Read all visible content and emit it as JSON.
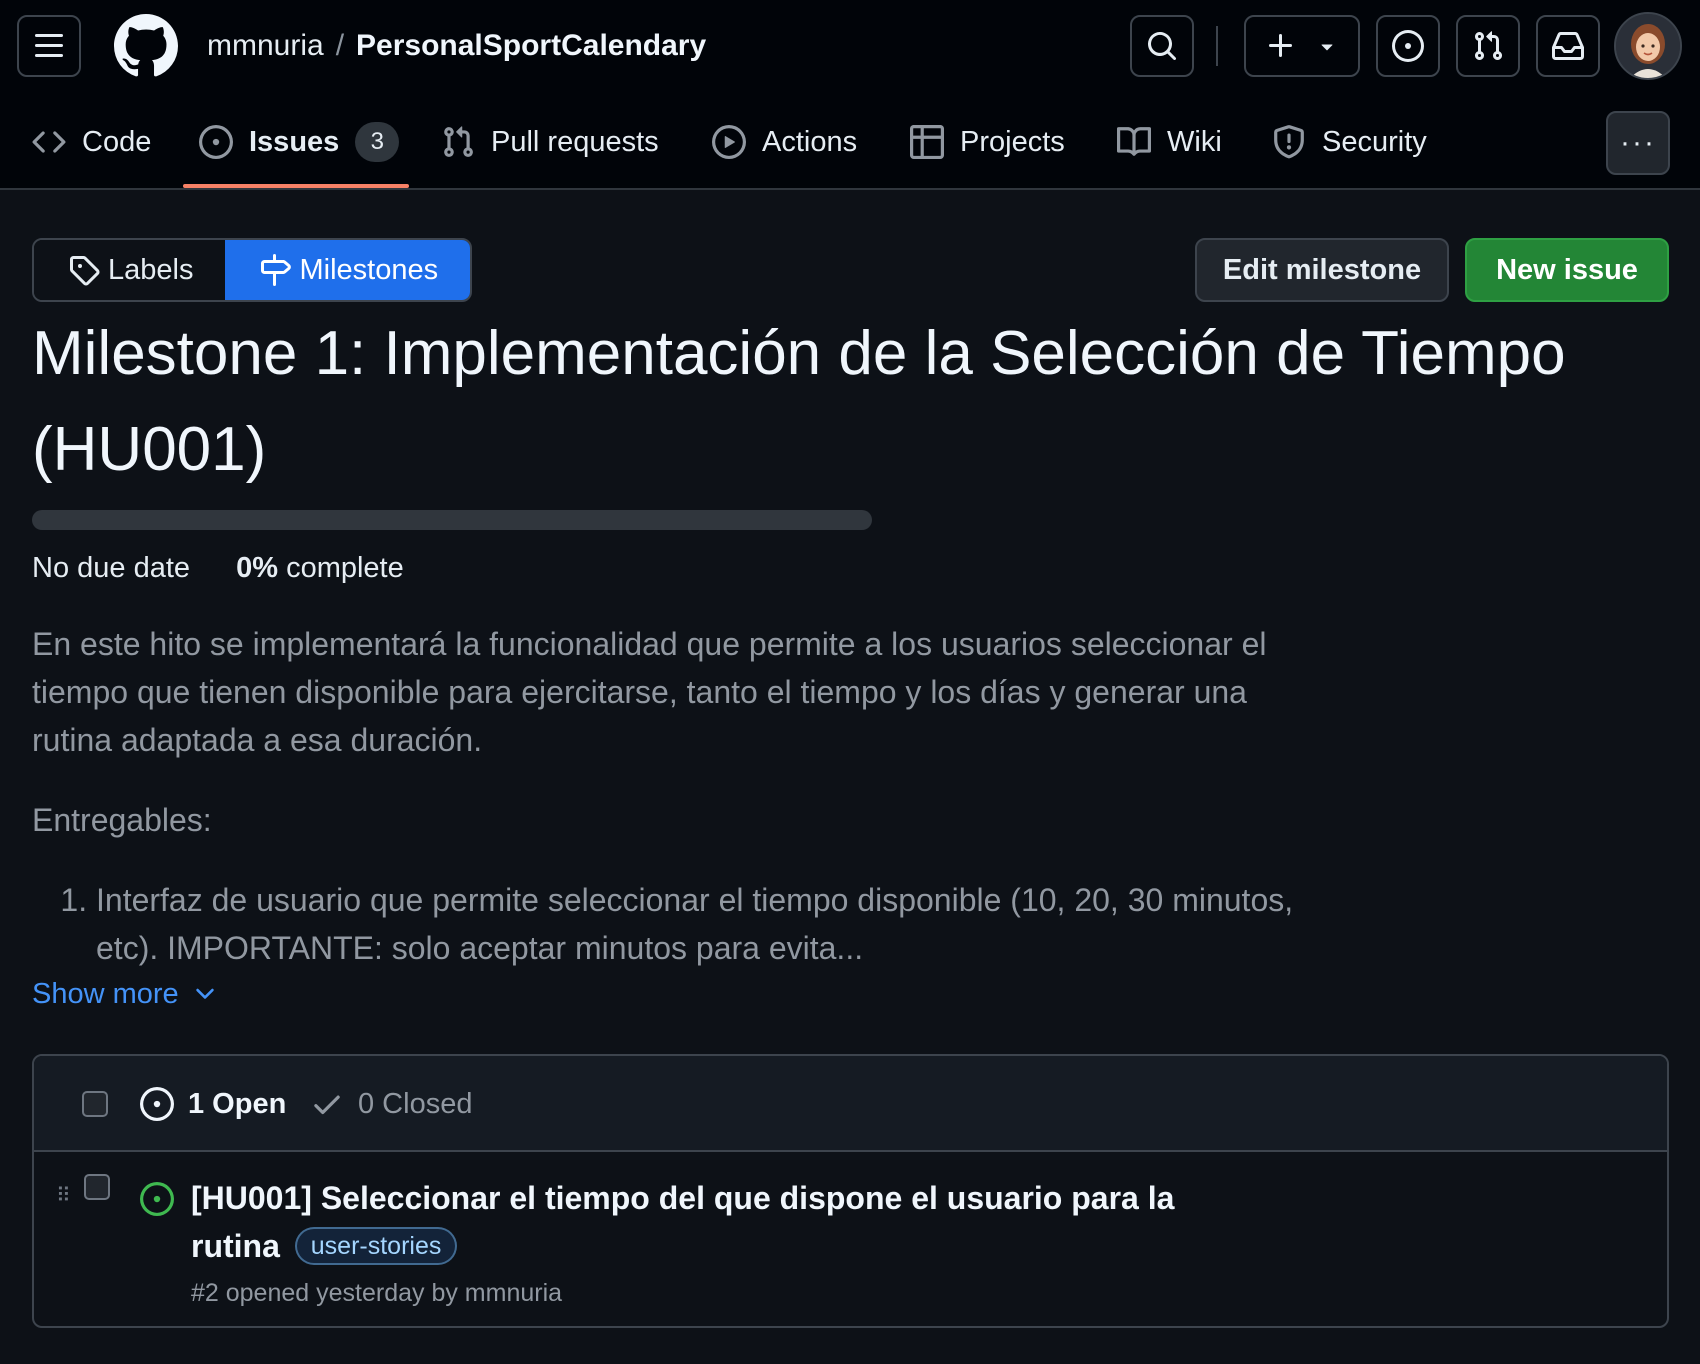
{
  "header": {
    "owner": "mmnuria",
    "separator": "/",
    "repo": "PersonalSportCalendary"
  },
  "nav": {
    "tabs": [
      {
        "label": "Code",
        "icon": "code-icon"
      },
      {
        "label": "Issues",
        "icon": "issue-opened-icon",
        "count": "3",
        "active": true
      },
      {
        "label": "Pull requests",
        "icon": "git-pull-request-icon"
      },
      {
        "label": "Actions",
        "icon": "play-icon"
      },
      {
        "label": "Projects",
        "icon": "table-icon"
      },
      {
        "label": "Wiki",
        "icon": "book-icon"
      },
      {
        "label": "Security",
        "icon": "shield-icon"
      }
    ],
    "more": "···"
  },
  "toolbar": {
    "labels": "Labels",
    "milestones": "Milestones",
    "edit_milestone": "Edit milestone",
    "new_issue": "New issue"
  },
  "milestone": {
    "title": "Milestone 1: Implementación de la Selección de Tiempo (HU001)",
    "progress_percent": 0,
    "due": "No due date",
    "percent": "0%",
    "percent_label": "complete",
    "description": {
      "paragraph": "En este hito se implementará la funcionalidad que permite a los usuarios seleccionar el tiempo que tienen disponible para ejercitarse, tanto el tiempo y los días y generar una rutina adaptada a esa duración.",
      "deliverables_heading": "Entregables:",
      "items": [
        "Interfaz de usuario que permite seleccionar el tiempo disponible (10, 20, 30 minutos, etc). IMPORTANTE: solo aceptar minutos para evita..."
      ]
    },
    "show_more": "Show more"
  },
  "issues": {
    "open_label": "1 Open",
    "closed_label": "0 Closed",
    "items": [
      {
        "title": "[HU001] Seleccionar el tiempo del que dispone el usuario para la rutina",
        "label": "user-stories",
        "meta": "#2 opened yesterday by mmnuria"
      }
    ]
  },
  "colors": {
    "background": "#0d1117",
    "header": "#010409",
    "accent_blue": "#1f6feb",
    "link": "#4493f8",
    "primary_green": "#238636",
    "open_green": "#3fb950",
    "tab_underline": "#f78166"
  }
}
